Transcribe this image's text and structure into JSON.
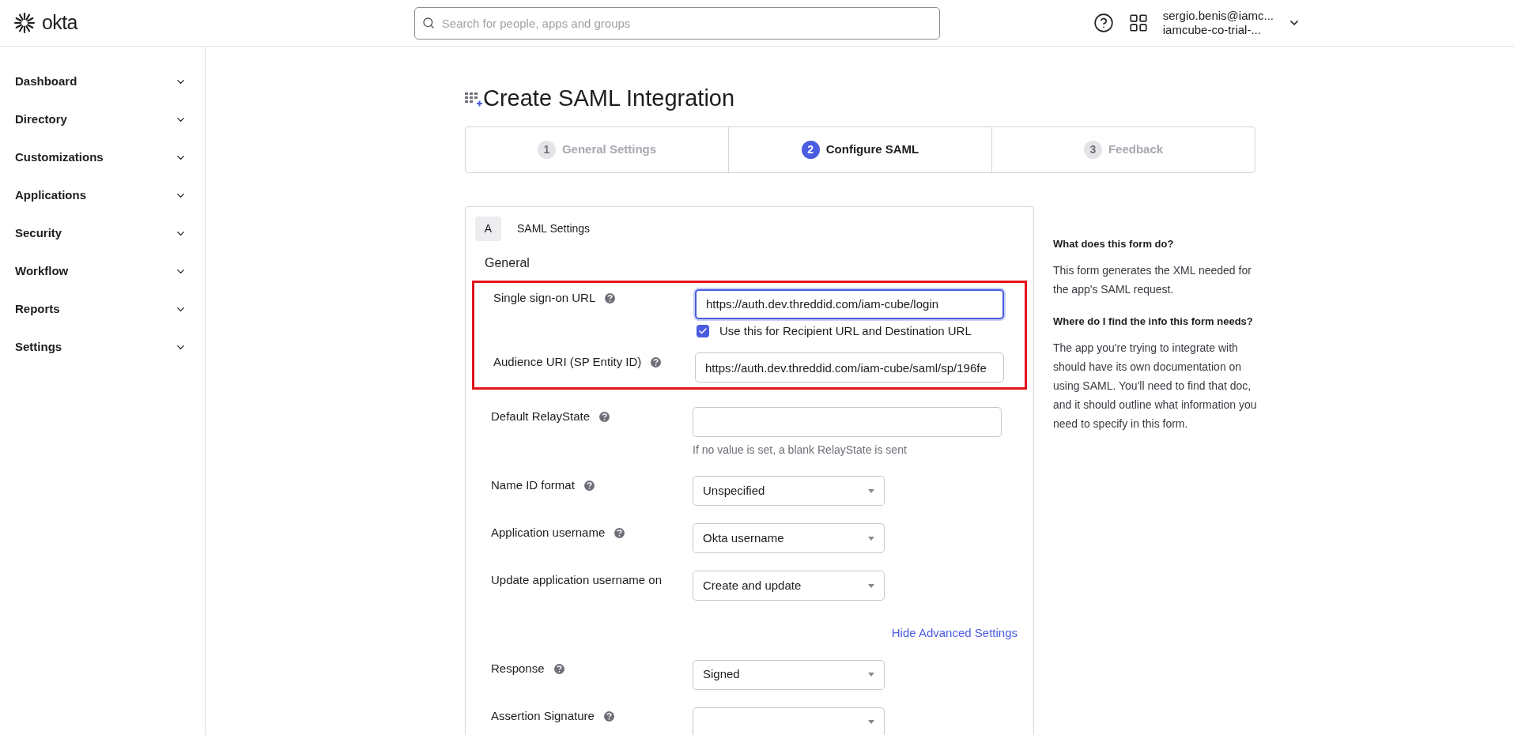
{
  "header": {
    "logo": "okta",
    "search": {
      "placeholder": "Search for people, apps and groups"
    },
    "user": {
      "email": "sergio.benis@iamc...",
      "org": "iamcube-co-trial-..."
    }
  },
  "sidebar": {
    "items": [
      {
        "label": "Dashboard",
        "expanded": false
      },
      {
        "label": "Directory",
        "expanded": false
      },
      {
        "label": "Customizations",
        "expanded": false
      },
      {
        "label": "Applications",
        "expanded": false
      },
      {
        "label": "Security",
        "expanded": false
      },
      {
        "label": "Workflow",
        "expanded": false
      },
      {
        "label": "Reports",
        "expanded": false
      },
      {
        "label": "Settings",
        "expanded": false
      }
    ]
  },
  "page": {
    "title": "Create SAML Integration",
    "steps": [
      {
        "number": "1",
        "label": "General Settings",
        "selected": false
      },
      {
        "number": "2",
        "label": "Configure SAML",
        "selected": true
      },
      {
        "number": "3",
        "label": "Feedback",
        "selected": false
      }
    ],
    "card": {
      "letter": "A",
      "title": "SAML Settings",
      "section": "General",
      "highlighted_fields": [
        {
          "kind": "text",
          "label": "Single sign-on URL",
          "help": true,
          "value": "https://auth.dev.threddid.com/iam-cube/login",
          "focused": true,
          "checkbox": {
            "label": "Use this for Recipient URL and Destination URL",
            "checked": true
          }
        },
        {
          "kind": "text",
          "label": "Audience URI (SP Entity ID)",
          "help": true,
          "value": "https://auth.dev.threddid.com/iam-cube/saml/sp/196fe",
          "focused": false
        }
      ],
      "fields": [
        {
          "kind": "text",
          "label": "Default RelayState",
          "help": true,
          "focused": false,
          "hint": "If no value is set, a blank RelayState is sent"
        },
        {
          "kind": "select",
          "label": "Name ID format",
          "help": true,
          "value": "Unspecified"
        },
        {
          "kind": "select",
          "label": "Application username",
          "help": true,
          "value": "Okta username"
        },
        {
          "kind": "select",
          "label": "Update application username on",
          "help": false,
          "value": "Create and update"
        },
        {
          "kind": "link",
          "label": "Hide Advanced Settings"
        },
        {
          "kind": "select",
          "label": "Response",
          "help": true,
          "value": "Signed"
        },
        {
          "kind": "select",
          "label": "Assertion Signature",
          "help": true
        }
      ]
    }
  },
  "help": {
    "sections": [
      {
        "heading": "What does this form do?",
        "text": "This form generates the XML needed for the app's SAML request."
      },
      {
        "heading": "Where do I find the info this form needs?",
        "text": "The app you're trying to integrate with should have its own documentation on using SAML. You'll need to find that doc, and it should outline what information you need to specify in this form."
      }
    ]
  }
}
